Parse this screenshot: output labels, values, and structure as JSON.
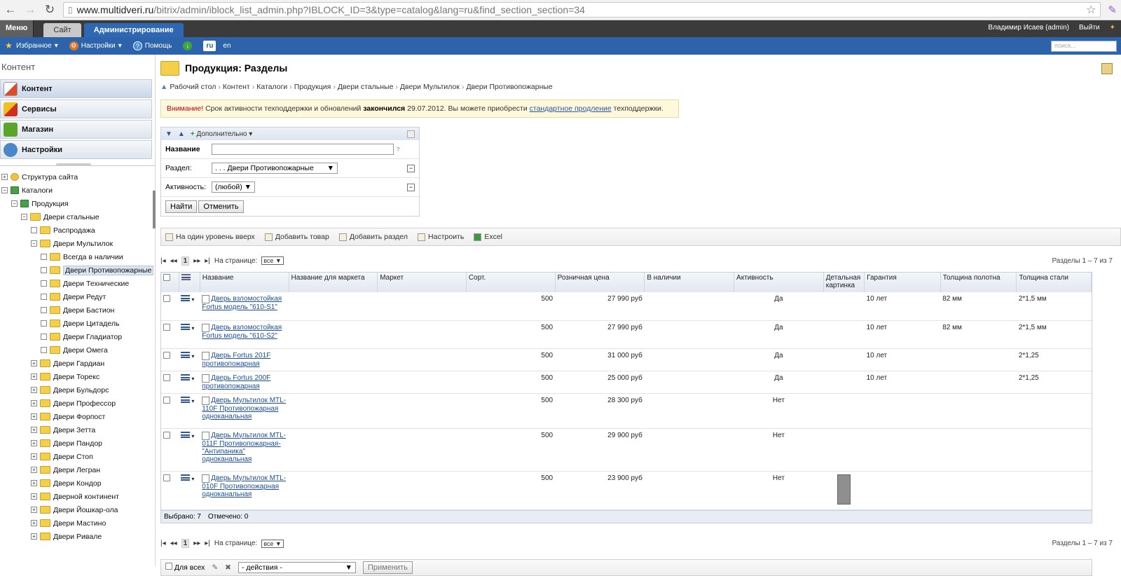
{
  "browser": {
    "url_host": "www.multidveri.ru",
    "url_path": "/bitrix/admin/iblock_list_admin.php?IBLOCK_ID=3&type=catalog&lang=ru&find_section_section=34"
  },
  "topbar": {
    "menu": "Меню",
    "tab_site": "Сайт",
    "tab_admin": "Администрирование",
    "user": "Владимир Исаев (admin)",
    "logout": "Выйти"
  },
  "toolbar": {
    "favorites": "Избранное",
    "settings": "Настройки",
    "help": "Помощь",
    "lang_ru": "ru",
    "lang_en": "en",
    "search_placeholder": "поиск..."
  },
  "sidebar": {
    "title": "Контент",
    "menu": [
      "Контент",
      "Сервисы",
      "Магазин",
      "Настройки"
    ],
    "tree": [
      {
        "t": "Структура сайта",
        "lvl": 0,
        "tg": "+"
      },
      {
        "t": "Каталоги",
        "lvl": 0,
        "tg": "−"
      },
      {
        "t": "Продукция",
        "lvl": 1,
        "tg": "−"
      },
      {
        "t": "Двери стальные",
        "lvl": 2,
        "tg": "−"
      },
      {
        "t": "Распродажа",
        "lvl": 3,
        "tg": "·"
      },
      {
        "t": "Двери Мультилок",
        "lvl": 3,
        "tg": "−"
      },
      {
        "t": "Всегда в наличии",
        "lvl": 4,
        "tg": "·"
      },
      {
        "t": "Двери Противопожарные",
        "lvl": 4,
        "tg": "·",
        "sel": true
      },
      {
        "t": "Двери Технические",
        "lvl": 4,
        "tg": "·"
      },
      {
        "t": "Двери Редут",
        "lvl": 4,
        "tg": "·"
      },
      {
        "t": "Двери Бастион",
        "lvl": 4,
        "tg": "·"
      },
      {
        "t": "Двери Цитадель",
        "lvl": 4,
        "tg": "·"
      },
      {
        "t": "Двери Гладиатор",
        "lvl": 4,
        "tg": "·"
      },
      {
        "t": "Двери Омега",
        "lvl": 4,
        "tg": "·"
      },
      {
        "t": "Двери Гардиан",
        "lvl": 3,
        "tg": "+"
      },
      {
        "t": "Двери Торекс",
        "lvl": 3,
        "tg": "+"
      },
      {
        "t": "Двери Бульдорс",
        "lvl": 3,
        "tg": "+"
      },
      {
        "t": "Двери Профессор",
        "lvl": 3,
        "tg": "+"
      },
      {
        "t": "Двери Форпост",
        "lvl": 3,
        "tg": "+"
      },
      {
        "t": "Двери Зетта",
        "lvl": 3,
        "tg": "+"
      },
      {
        "t": "Двери Пандор",
        "lvl": 3,
        "tg": "+"
      },
      {
        "t": "Двери Стоп",
        "lvl": 3,
        "tg": "+"
      },
      {
        "t": "Двери Легран",
        "lvl": 3,
        "tg": "+"
      },
      {
        "t": "Двери Кондор",
        "lvl": 3,
        "tg": "+"
      },
      {
        "t": "Дверной континент",
        "lvl": 3,
        "tg": "+"
      },
      {
        "t": "Двери Йошкар-ола",
        "lvl": 3,
        "tg": "+"
      },
      {
        "t": "Двери Мастино",
        "lvl": 3,
        "tg": "+"
      },
      {
        "t": "Двери Ривале",
        "lvl": 3,
        "tg": "+"
      }
    ]
  },
  "main": {
    "title": "Продукция: Разделы",
    "breadcrumbs": [
      "Рабочий стол",
      "Контент",
      "Каталоги",
      "Продукция",
      "Двери стальные",
      "Двери Мультилок",
      "Двери Противопожарные"
    ],
    "warning": {
      "label": "Внимание!",
      "text1": " Срок активности техподдержки и обновлений ",
      "bold": "закончился",
      "text2": " 29.07.2012. Вы можете приобрести ",
      "link": "стандартное продление",
      "text3": " техподдержки."
    },
    "filter": {
      "more": "Дополнительно",
      "name_label": "Название",
      "section_label": "Раздел:",
      "section_value": ". . . Двери Противопожарные",
      "active_label": "Активность:",
      "active_value": "(любой)",
      "find": "Найти",
      "cancel": "Отменить"
    },
    "actions": [
      "На один уровень вверх",
      "Добавить товар",
      "Добавить раздел",
      "Настроить",
      "Excel"
    ],
    "pager": {
      "page": "1",
      "per_page_label": "На странице:",
      "per_page": "все",
      "count": "Разделы 1 – 7 из 7"
    },
    "columns": [
      "Название",
      "Название для маркета",
      "Маркет",
      "Сорт.",
      "Розничная цена",
      "В наличии",
      "Активность",
      "Детальная картинка",
      "Гарантия",
      "Толщина полотна",
      "Толщина стали"
    ],
    "rows": [
      {
        "name": "Дверь взломостойкая Fortus модель \"610-S1\"",
        "sort": "500",
        "price": "27 990 руб",
        "active": "Да",
        "guarantee": "10 лет",
        "thick": "82 мм",
        "steel": "2*1,5 мм"
      },
      {
        "name": "Дверь взломостойкая Fortus модель \"610-S2\"",
        "sort": "500",
        "price": "27 990 руб",
        "active": "Да",
        "guarantee": "10 лет",
        "thick": "82 мм",
        "steel": "2*1,5 мм"
      },
      {
        "name": "Дверь Fortus 201F противопожарная",
        "sort": "500",
        "price": "31 000 руб",
        "active": "Да",
        "guarantee": "10 лет",
        "thick": "",
        "steel": "2*1,25"
      },
      {
        "name": "Дверь Fortus 200F противопожарная",
        "sort": "500",
        "price": "25 000 руб",
        "active": "Да",
        "guarantee": "10 лет",
        "thick": "",
        "steel": "2*1,25"
      },
      {
        "name": "Дверь Мультилок MTL-110F Противопожарная одноканальная",
        "sort": "500",
        "price": "28 300 руб",
        "active": "Нет",
        "guarantee": "",
        "thick": "",
        "steel": ""
      },
      {
        "name": "Дверь Мультилок MTL-011F Противопожарная-\"Антипаника\" одноканальная",
        "sort": "500",
        "price": "29 900 руб",
        "active": "Нет",
        "guarantee": "",
        "thick": "",
        "steel": ""
      },
      {
        "name": "Дверь Мультилок MTL-010F Противопожарная одноканальная",
        "sort": "500",
        "price": "23 900 руб",
        "active": "Нет",
        "guarantee": "",
        "thick": "",
        "steel": "",
        "img": true
      }
    ],
    "footer": {
      "selected": "Выбрано: 7",
      "checked": "Отмечено: 0"
    },
    "bottom": {
      "for_all": "Для всех",
      "actions": "- действия -",
      "apply": "Применить"
    }
  }
}
